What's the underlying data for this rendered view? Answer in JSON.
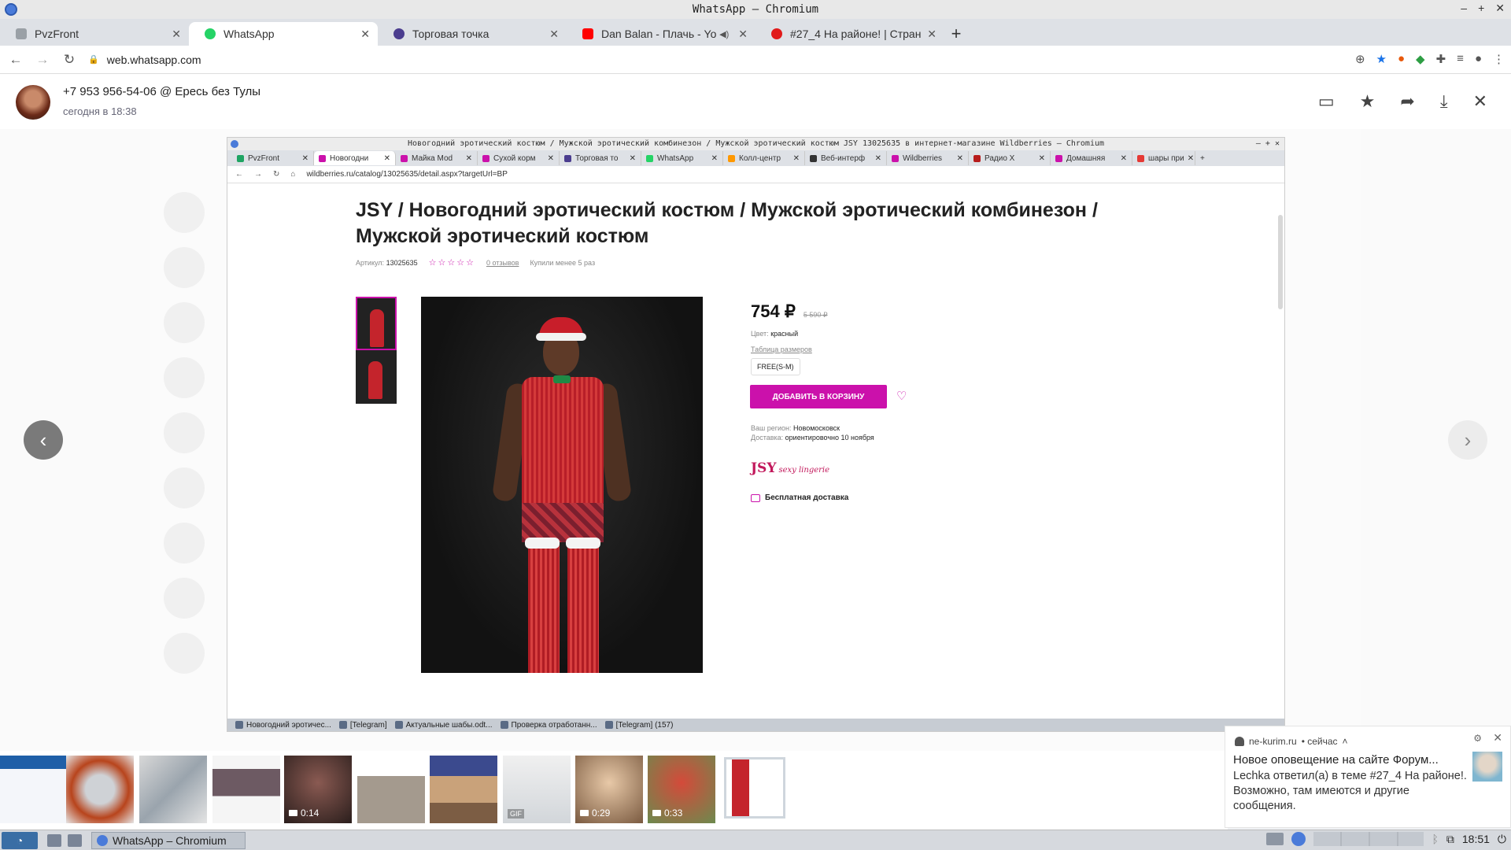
{
  "window": {
    "title": "WhatsApp – Chromium"
  },
  "browser": {
    "tabs": [
      {
        "label": "PvzFront",
        "color": "#9aa0a6"
      },
      {
        "label": "WhatsApp",
        "color": "#25d366",
        "active": true
      },
      {
        "label": "Торговая точка",
        "color": "#4b3d8f"
      },
      {
        "label": "Dan Balan - Плачь - Yo",
        "color": "#ff0000",
        "audio": true
      },
      {
        "label": "#27_4 На районе! | Стран",
        "color": "#e11a1a"
      }
    ],
    "url": "web.whatsapp.com"
  },
  "viewer": {
    "contact": "+7 953 956-54-06 @ Ересь без Тулы",
    "timestamp": "сегодня в 18:38"
  },
  "screenshot": {
    "title": "Новогодний эротический костюм / Мужской эротический комбинезон / Мужской эротический костюм JSY 13025635 в интернет-магазине Wildberries – Chromium",
    "tabs": [
      {
        "label": "PvzFront",
        "color": "#1fa463"
      },
      {
        "label": "Новогодни",
        "color": "#cb11ab",
        "active": true
      },
      {
        "label": "Майка Моd",
        "color": "#cb11ab"
      },
      {
        "label": "Сухой корм",
        "color": "#cb11ab"
      },
      {
        "label": "Торговая то",
        "color": "#4b3d8f"
      },
      {
        "label": "WhatsApp",
        "color": "#25d366"
      },
      {
        "label": "Колл-центр",
        "color": "#ff9800"
      },
      {
        "label": "Веб-интерф",
        "color": "#333333"
      },
      {
        "label": "Wildberries",
        "color": "#cb11ab"
      },
      {
        "label": "Радио Х",
        "color": "#b71c1c"
      },
      {
        "label": "Домашняя",
        "color": "#cb11ab"
      },
      {
        "label": "шары при",
        "color": "#e53935"
      }
    ],
    "url": "wildberries.ru/catalog/13025635/detail.aspx?targetUrl=BP",
    "product": {
      "title": "JSY / Новогодний эротический костюм / Мужской эротический комбинезон / Мужской эротический костюм",
      "article_label": "Артикул:",
      "article": "13025635",
      "stars": "☆☆☆☆☆",
      "reviews": "0 отзывов",
      "bought": "Купили менее 5 раз",
      "price": "754 ₽",
      "old_price": "5 590 ₽",
      "color_label": "Цвет:",
      "color": "красный",
      "size_table": "Таблица размеров",
      "size": "FREE(S-M)",
      "add_to_cart": "ДОБАВИТЬ В КОРЗИНУ",
      "region_label": "Ваш регион:",
      "region": "Новомосковск",
      "delivery_label": "Доставка:",
      "delivery": "ориентировочно 10 ноября",
      "brand_mark": "JSY",
      "brand_tag": "sexy lingerie",
      "free_delivery": "Бесплатная доставка"
    },
    "taskbar": [
      "Новогодний эротичес...",
      "[Telegram]",
      "Актуальные шабы.odt...",
      "Проверка отработанн...",
      "[Telegram] (157)"
    ]
  },
  "media": [
    {
      "kind": "image"
    },
    {
      "kind": "image"
    },
    {
      "kind": "image"
    },
    {
      "kind": "image"
    },
    {
      "kind": "video",
      "duration": "0:14"
    },
    {
      "kind": "image"
    },
    {
      "kind": "image"
    },
    {
      "kind": "gif",
      "label": "GIF"
    },
    {
      "kind": "video",
      "duration": "0:29"
    },
    {
      "kind": "video",
      "duration": "0:33"
    },
    {
      "kind": "image",
      "current": true
    }
  ],
  "notification": {
    "source": "ne-kurim.ru",
    "time": "• сейчас",
    "title": "Новое оповещение на сайте Форум...",
    "body": "Lechka ответил(а) в теме #27_4 На районе!. Возможно, там имеются и другие сообщения."
  },
  "os": {
    "app": "WhatsApp – Chromium",
    "clock": "18:51"
  }
}
